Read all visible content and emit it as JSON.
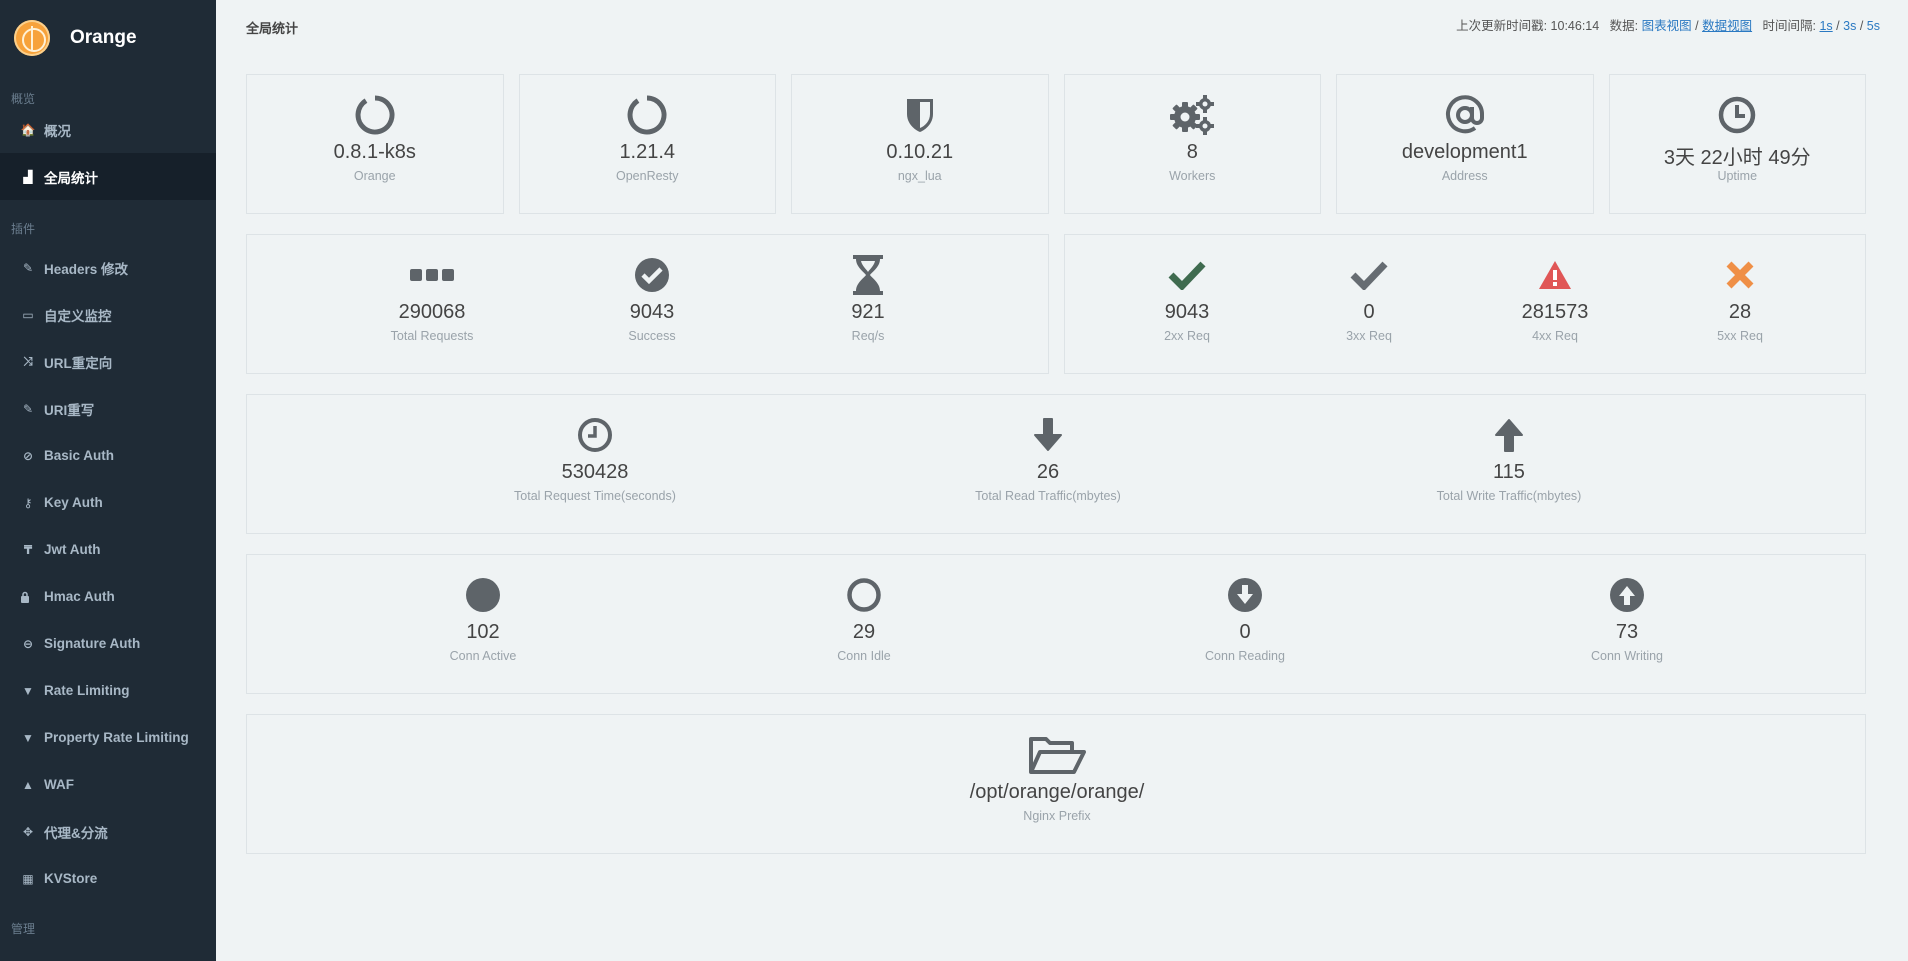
{
  "brand": {
    "name": "Orange"
  },
  "sidebar": {
    "sections": [
      "概览",
      "插件",
      "管理"
    ],
    "items": [
      {
        "label": "概况",
        "icon": "home-icon",
        "glyph": "🏠"
      },
      {
        "label": "全局统计",
        "icon": "bar-chart-icon",
        "glyph": "▟"
      },
      {
        "label": "Headers 修改",
        "icon": "edit-icon",
        "glyph": "✎"
      },
      {
        "label": "自定义监控",
        "icon": "desktop-icon",
        "glyph": "▭"
      },
      {
        "label": "URL重定向",
        "icon": "random-icon",
        "glyph": "⤨"
      },
      {
        "label": "URI重写",
        "icon": "edit-icon",
        "glyph": "✎"
      },
      {
        "label": "Basic Auth",
        "icon": "ban-icon",
        "glyph": "⊘"
      },
      {
        "label": "Key Auth",
        "icon": "key-icon",
        "glyph": "⚷"
      },
      {
        "label": "Jwt Auth",
        "icon": "jwt-icon",
        "glyph": "₸"
      },
      {
        "label": "Hmac Auth",
        "icon": "lock-icon",
        "glyph": "🔒"
      },
      {
        "label": "Signature Auth",
        "icon": "minus-circle-icon",
        "glyph": "⊖"
      },
      {
        "label": "Rate Limiting",
        "icon": "filter-icon",
        "glyph": "▼"
      },
      {
        "label": "Property Rate Limiting",
        "icon": "filter-icon",
        "glyph": "▼"
      },
      {
        "label": "WAF",
        "icon": "warning-icon",
        "glyph": "▲"
      },
      {
        "label": "代理&分流",
        "icon": "arrows-icon",
        "glyph": "✥"
      },
      {
        "label": "KVStore",
        "icon": "grid-icon",
        "glyph": "▦"
      }
    ],
    "active_index": 1
  },
  "header": {
    "title": "全局统计",
    "last_update_label": "上次更新时间戳:",
    "last_update_time": "10:46:14",
    "data_label": "数据:",
    "chart_view": "图表视图",
    "sep1": "/",
    "data_view": "数据视图",
    "interval_label": "时间间隔:",
    "intervals": [
      "1s",
      "3s",
      "5s"
    ],
    "sep2": "/",
    "sep3": "/"
  },
  "info_cards": [
    {
      "value": "0.8.1-k8s",
      "label": "Orange",
      "icon": "circle-notch-icon"
    },
    {
      "value": "1.21.4",
      "label": "OpenResty",
      "icon": "circle-notch-icon"
    },
    {
      "value": "0.10.21",
      "label": "ngx_lua",
      "icon": "shield-icon"
    },
    {
      "value": "8",
      "label": "Workers",
      "icon": "gears-icon"
    },
    {
      "value": "development1",
      "label": "Address",
      "icon": "at-icon"
    },
    {
      "value": "3天 22小时 49分",
      "label": "Uptime",
      "icon": "clock-icon"
    }
  ],
  "request_stats": [
    {
      "value": "290068",
      "label": "Total Requests",
      "icon": "ellipsis-icon"
    },
    {
      "value": "9043",
      "label": "Success",
      "icon": "check-circle-icon"
    },
    {
      "value": "921",
      "label": "Req/s",
      "icon": "hourglass-icon"
    }
  ],
  "status_stats": [
    {
      "value": "9043",
      "label": "2xx Req",
      "icon": "check-icon",
      "color": "#3f6b4f"
    },
    {
      "value": "0",
      "label": "3xx Req",
      "icon": "check-icon",
      "color": "#666c72"
    },
    {
      "value": "281573",
      "label": "4xx Req",
      "icon": "warning-icon",
      "color": "#e05656"
    },
    {
      "value": "28",
      "label": "5xx Req",
      "icon": "times-icon",
      "color": "#ef8f46"
    }
  ],
  "traffic_stats": [
    {
      "value": "530428",
      "label": "Total Request Time(seconds)",
      "icon": "clock-icon"
    },
    {
      "value": "26",
      "label": "Total Read Traffic(mbytes)",
      "icon": "arrow-down-icon"
    },
    {
      "value": "115",
      "label": "Total Write Traffic(mbytes)",
      "icon": "arrow-up-icon"
    }
  ],
  "conn_stats": [
    {
      "value": "102",
      "label": "Conn Active",
      "icon": "circle-icon"
    },
    {
      "value": "29",
      "label": "Conn Idle",
      "icon": "circle-o-icon"
    },
    {
      "value": "0",
      "label": "Conn Reading",
      "icon": "arrow-circle-down-icon"
    },
    {
      "value": "73",
      "label": "Conn Writing",
      "icon": "arrow-circle-up-icon"
    }
  ],
  "prefix": {
    "value": "/opt/orange/orange/",
    "label": "Nginx Prefix",
    "icon": "folder-open-icon"
  },
  "colors": {
    "sidebar_bg": "#1f2b36",
    "icon_gray": "#5e6469",
    "link": "#2a79c2"
  }
}
